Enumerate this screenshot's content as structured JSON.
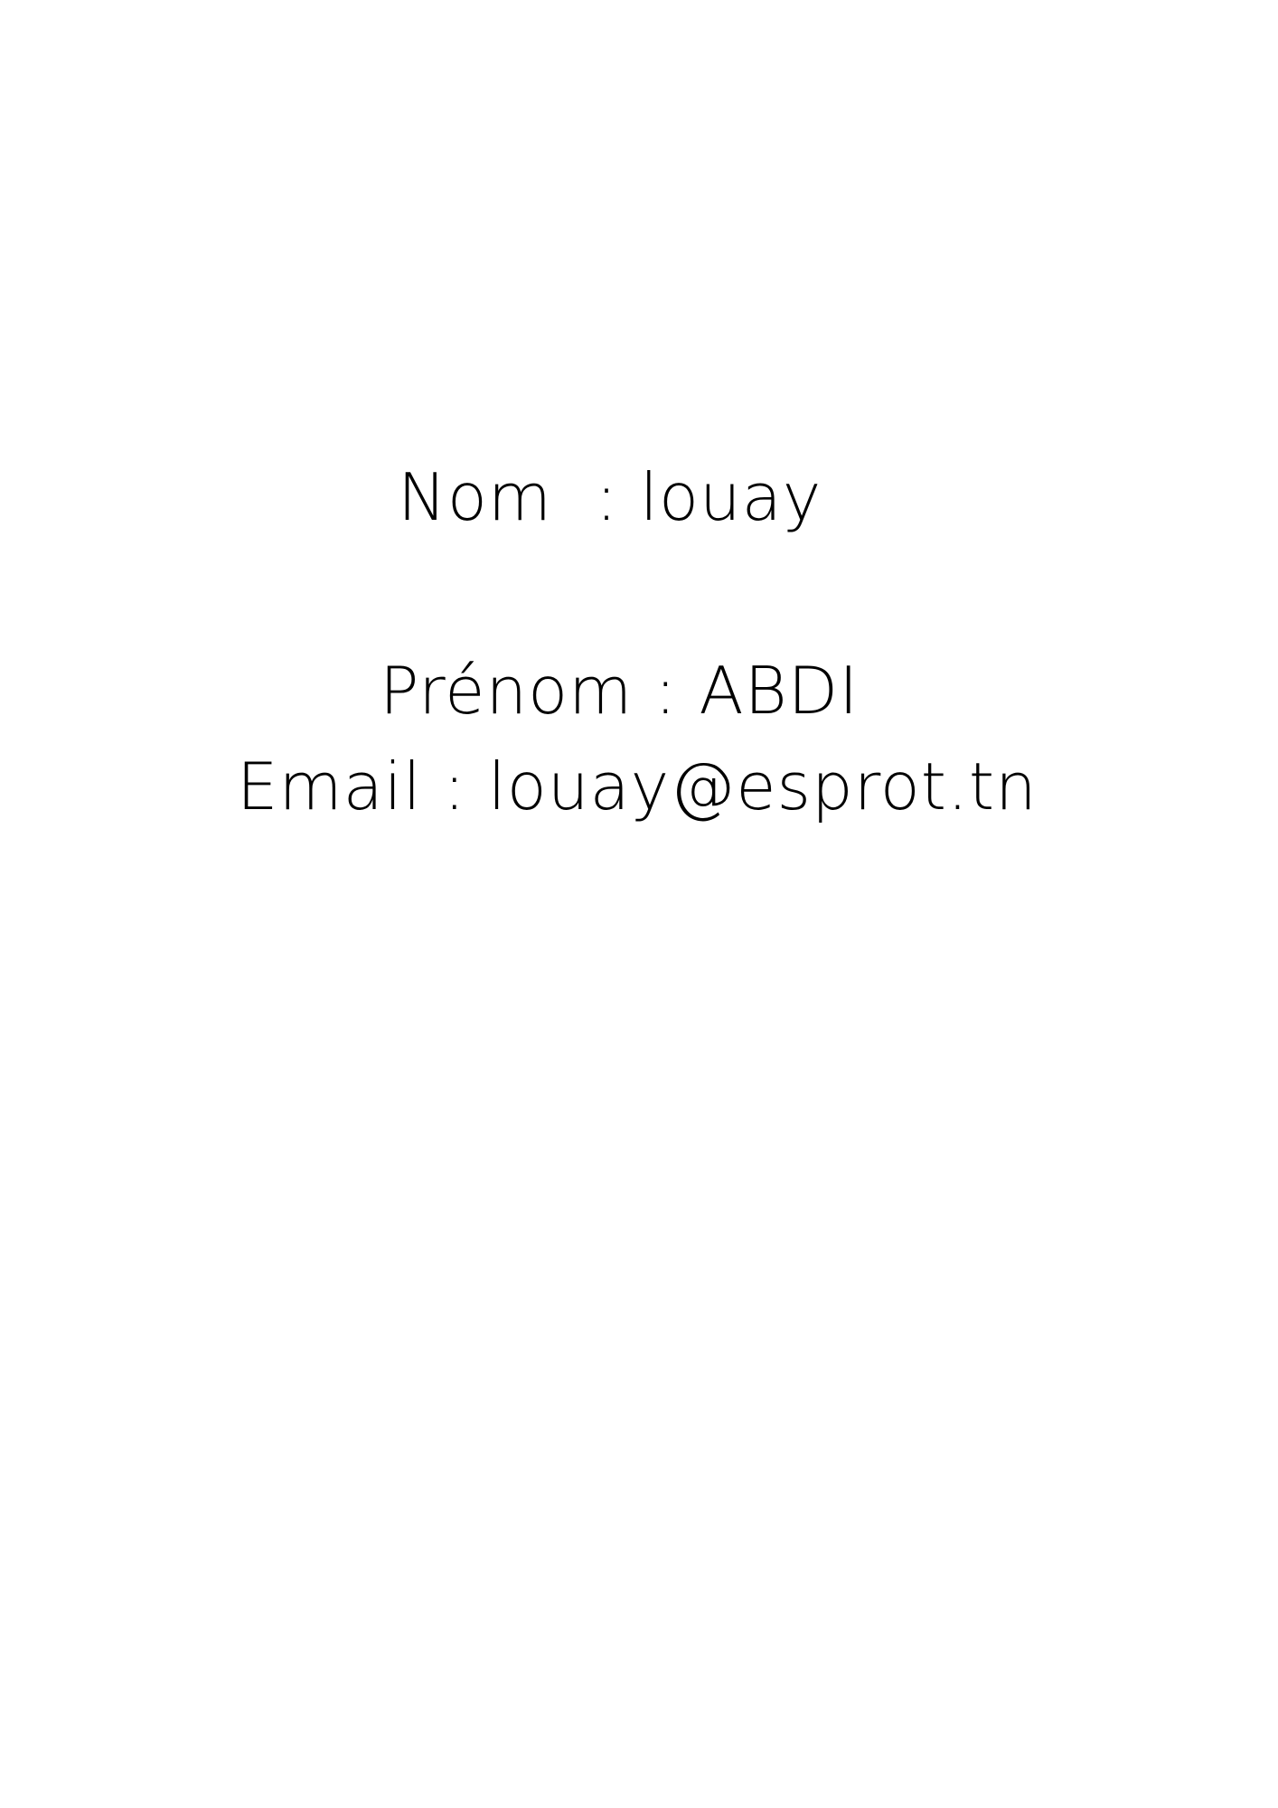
{
  "document": {
    "nom_label": "Nom",
    "nom_separator": "  : ",
    "nom_value": "louay",
    "prenom_label": "Prénom",
    "prenom_separator": " : ",
    "prenom_value": "ABDI",
    "email_label": "Email",
    "email_separator": " : ",
    "email_value": "louay@esprot.tn"
  }
}
